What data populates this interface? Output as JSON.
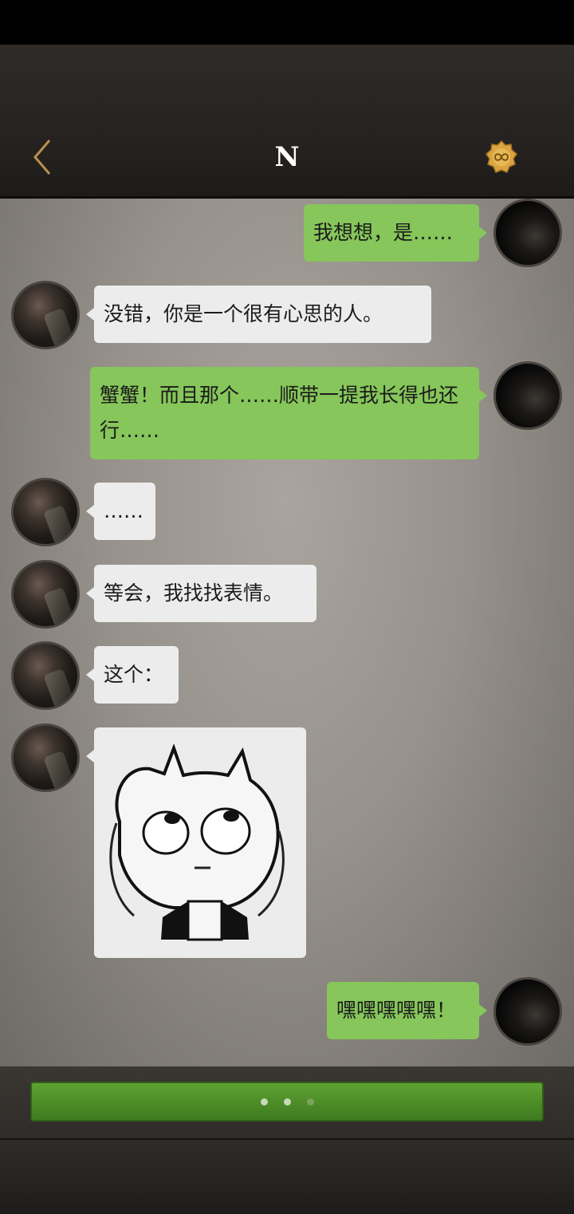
{
  "header": {
    "title": "N",
    "back_icon": "chevron-left-icon",
    "badge_icon": "gold-infinity-badge-icon"
  },
  "messages": [
    {
      "side": "out",
      "text": "我想想，是……"
    },
    {
      "side": "in",
      "text": "没错，你是一个很有心思的人。"
    },
    {
      "side": "out",
      "text": "蟹蟹！而且那个……顺带一提我长得也还行……"
    },
    {
      "side": "in",
      "text": "……"
    },
    {
      "side": "in",
      "text": "等会，我找找表情。"
    },
    {
      "side": "in",
      "text": "这个："
    },
    {
      "side": "in",
      "type": "sticker",
      "sticker_icon": "cat-rolling-eyes-sticker"
    },
    {
      "side": "out",
      "text": "嘿嘿嘿嘿嘿！"
    }
  ],
  "input_bar": {
    "page_indicator": {
      "count": 3,
      "active": 0
    }
  },
  "colors": {
    "outgoing_bubble": "#86c65a",
    "incoming_bubble": "#ececec",
    "input_bar": "#5ea232"
  }
}
